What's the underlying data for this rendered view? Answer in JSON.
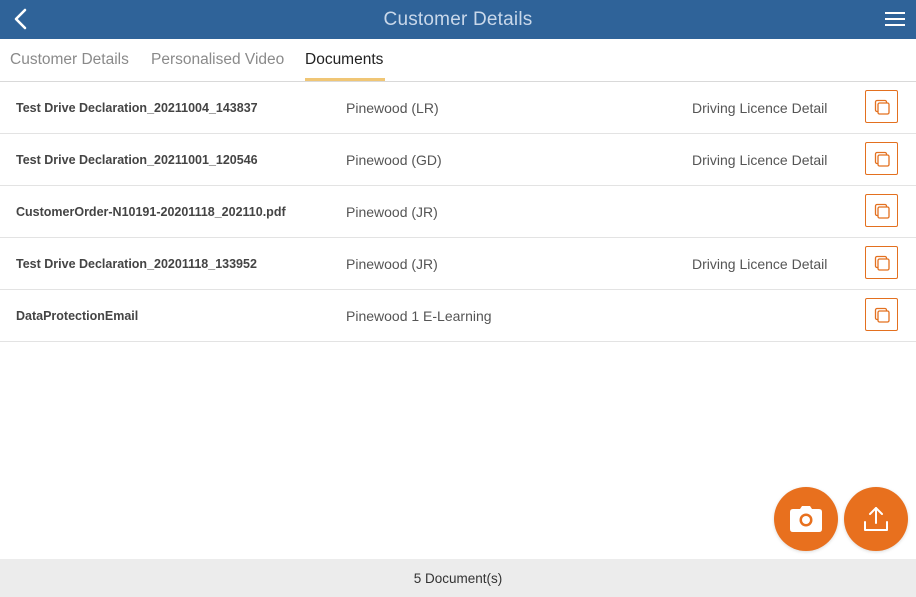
{
  "header": {
    "title": "Customer Details",
    "back_icon": "chevron-left-icon",
    "menu_icon": "hamburger-menu-icon",
    "bg_color": "#2f6399"
  },
  "tabs": [
    {
      "label": "Customer Details",
      "active": false
    },
    {
      "label": "Personalised Video",
      "active": false
    },
    {
      "label": "Documents",
      "active": true
    }
  ],
  "documents": [
    {
      "name": "Test Drive Declaration_20211004_143837",
      "location": "Pinewood (LR)",
      "type": "Driving Licence Detail"
    },
    {
      "name": "Test Drive Declaration_20211001_120546",
      "location": "Pinewood (GD)",
      "type": "Driving Licence Detail"
    },
    {
      "name": "CustomerOrder-N10191-20201118_202110.pdf",
      "location": "Pinewood (JR)",
      "type": ""
    },
    {
      "name": "Test Drive Declaration_20201118_133952",
      "location": "Pinewood (JR)",
      "type": "Driving Licence Detail"
    },
    {
      "name": "DataProtectionEmail",
      "location": "Pinewood 1 E-Learning",
      "type": ""
    }
  ],
  "row_action_icon": "copy-icon",
  "fabs": {
    "camera_icon": "camera-icon",
    "upload_icon": "upload-icon",
    "color": "#e8701e"
  },
  "footer": {
    "count_text": "5 Document(s)"
  }
}
